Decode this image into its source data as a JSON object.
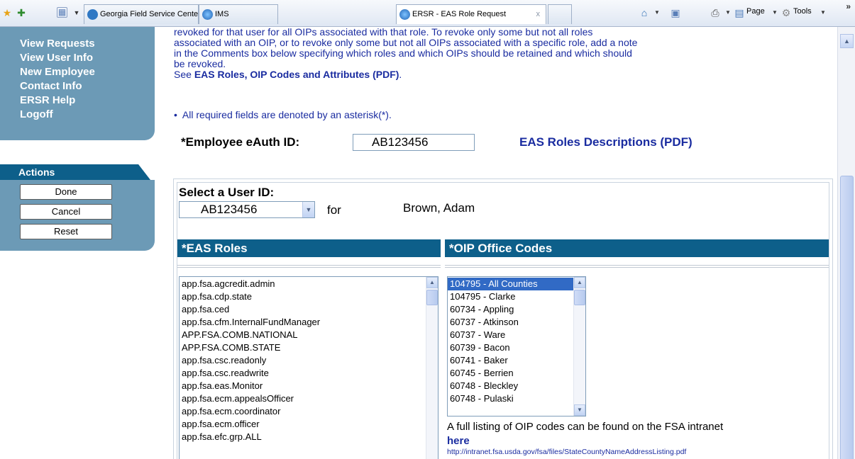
{
  "browser": {
    "tabs": [
      {
        "label": "Georgia Field Service Center ..."
      },
      {
        "label": "IMS"
      },
      {
        "label": "ERSR - EAS Role Request",
        "close": "x"
      }
    ],
    "right_tools": {
      "page_label": "Page",
      "tools_label": "Tools"
    }
  },
  "nav": {
    "links": [
      "View Requests",
      "View User Info",
      "New Employee",
      "Contact Info",
      "ERSR Help",
      "Logoff"
    ]
  },
  "actions": {
    "title": "Actions",
    "buttons": [
      "Done",
      "Cancel",
      "Reset"
    ]
  },
  "info": {
    "line1": "revoked for that user for all OIPs associated with that role. To revoke only some but not all roles",
    "line2": "associated with an OIP, or to revoke only some but not all OIPs associated with a specific role, add a note",
    "line3": "in the Comments box below specifying which roles and which OIPs should be retained and which should",
    "line4": "be revoked.",
    "see_prefix": "See ",
    "see_link": "EAS Roles, OIP Codes and Attributes (PDF)",
    "see_suffix": ".",
    "bullet": "All required fields are denoted by an asterisk(*)."
  },
  "eauth": {
    "label": "*Employee eAuth ID:",
    "value": "AB123456",
    "desc_link": "EAS Roles Descriptions (PDF)"
  },
  "user_select": {
    "label": "Select a User ID:",
    "value": "AB123456",
    "for_label": "for",
    "name": "Brown, Adam"
  },
  "eas_roles": {
    "header": "*EAS Roles",
    "items": [
      "app.fsa.agcredit.admin",
      "app.fsa.cdp.state",
      "app.fsa.ced",
      "app.fsa.cfm.InternalFundManager",
      "APP.FSA.COMB.NATIONAL",
      "APP.FSA.COMB.STATE",
      "app.fsa.csc.readonly",
      "app.fsa.csc.readwrite",
      "app.fsa.eas.Monitor",
      "app.fsa.ecm.appealsOfficer",
      "app.fsa.ecm.coordinator",
      "app.fsa.ecm.officer",
      "app.fsa.efc.grp.ALL"
    ]
  },
  "oip": {
    "header": "*OIP Office Codes",
    "items": [
      "104795 - All Counties",
      "104795 - Clarke",
      "60734 - Appling",
      "60737 - Atkinson",
      "60737 - Ware",
      "60739 - Bacon",
      "60741 - Baker",
      "60745 - Berrien",
      "60748 - Bleckley",
      "60748 - Pulaski"
    ],
    "selected_index": 0,
    "note": "A full listing of OIP codes can be found on the FSA intranet",
    "here_link": "here",
    "url": "http://intranet.fsa.usda.gov/fsa/files/StateCountyNameAddressListing.pdf"
  },
  "colors": {
    "nav_bg": "#6c9ab6",
    "header_bg": "#0d5f8a",
    "link_blue": "#1a2ca0",
    "selection": "#316ac5"
  }
}
